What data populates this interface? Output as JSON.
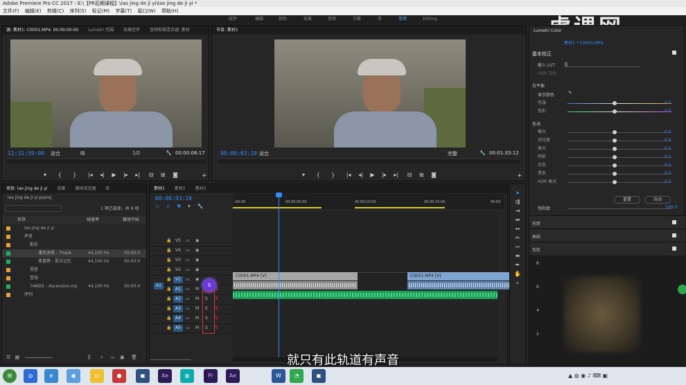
{
  "app": {
    "title": "Adobe Premiere Pro CC 2017 - E:\\【PR后期课程】\\lao jing de ji yi\\lao jing de ji yi *"
  },
  "menu": [
    "文件(F)",
    "编辑(E)",
    "剪辑(C)",
    "序列(S)",
    "标记(M)",
    "字幕(T)",
    "窗口(W)",
    "帮助(H)"
  ],
  "workspaces": [
    "组件",
    "编辑",
    "颜色",
    "效果",
    "音频",
    "字幕",
    "库",
    "常用",
    "Editing"
  ],
  "watermark": "虎课网",
  "source_panel": {
    "tabs": [
      "源: 素材1: C0001.MP4: 00:00:00:00",
      "Lumetri 范围",
      "效果控件",
      "音频剪辑混合器: 素材"
    ],
    "timecode": "12:31:59:00",
    "fit": "适合",
    "ratio": "1/2",
    "duration": "00:00:06:17"
  },
  "program_panel": {
    "tabs": [
      "节目: 素材1"
    ],
    "timecode": "00:00:03:10",
    "fit": "适合",
    "quality": "完整",
    "duration": "00:01:35:12"
  },
  "project_panel": {
    "tabs": [
      "项目: lao jing de ji yi",
      "效果",
      "媒体浏览器",
      "库"
    ],
    "filename": "lao jing de ji yi.prproj",
    "selection": "1 项已选择，共 9 项",
    "columns": [
      "名称",
      "帧速率",
      "媒体开始"
    ],
    "rows": [
      {
        "name": "lao jing de ji yi",
        "rate": "",
        "start": "",
        "color": "#e8a13a"
      },
      {
        "name": "声音",
        "rate": "",
        "start": "",
        "color": "#e8a13a"
      },
      {
        "name": "配乐",
        "rate": "",
        "start": "",
        "color": "#e8a13a"
      },
      {
        "name": "潘若迪恩 - Thank",
        "rate": "44,100 Hz",
        "start": "00:00:0",
        "color": "#1fb35a"
      },
      {
        "name": "蒋喜鹊 - 夏日记忆",
        "rate": "44,100 Hz",
        "start": "00:00:0",
        "color": "#1fb35a"
      },
      {
        "name": "视音",
        "rate": "",
        "start": "",
        "color": "#e8a13a"
      },
      {
        "name": "音效",
        "rate": "",
        "start": "",
        "color": "#e8a13a"
      },
      {
        "name": "7AND5 - Ascension.mp",
        "rate": "44,100 Hz",
        "start": "00:00:0",
        "color": "#1fb35a"
      },
      {
        "name": "序列",
        "rate": "",
        "start": "",
        "color": "#e8a13a"
      }
    ]
  },
  "timeline": {
    "tabs": [
      "素材1",
      "素材2",
      "素材3"
    ],
    "timecode": "00:00:03:10",
    "ruler": [
      ":00:00",
      "00:00:05:00",
      "00:00:10:00",
      "00:00:15:00",
      "00:00"
    ],
    "video_tracks": [
      "V5",
      "V4",
      "V3",
      "V2",
      "V1"
    ],
    "audio_tracks": [
      "A1",
      "A2",
      "A3",
      "A4",
      "A5"
    ],
    "source_patch": "A1",
    "clips": [
      {
        "label": "C0001.MP4 [V]",
        "start": 0,
        "end": 5.0
      },
      {
        "label": "C0051.MP4 [V]",
        "start": 7.0,
        "end": 11.5
      }
    ],
    "mute_letter": "M",
    "solo_letter": "S",
    "solo_button": "S",
    "mute_active": "M"
  },
  "lumetri": {
    "title": "Lumetri Color",
    "clip": "素材1 * C0001.MP4",
    "section": "基本校正",
    "lut_label": "输入 LUT",
    "lut_value": "无",
    "hdr_label": "HDR 白色",
    "wb_label": "白平衡",
    "picker_label": "显示颜色",
    "wb": [
      {
        "label": "色温",
        "value": "0.0"
      },
      {
        "label": "色彩",
        "value": "0.0"
      }
    ],
    "tone_label": "色调",
    "tone": [
      {
        "label": "曝光",
        "value": "0.0"
      },
      {
        "label": "对比度",
        "value": "0.0"
      },
      {
        "label": "高光",
        "value": "0.0"
      },
      {
        "label": "阴影",
        "value": "0.0"
      },
      {
        "label": "白色",
        "value": "0.0"
      },
      {
        "label": "黑色",
        "value": "0.0"
      },
      {
        "label": "HDR 高光",
        "value": "0.0"
      }
    ],
    "reset": "重置",
    "auto": "自动",
    "saturation_label": "饱和度",
    "saturation_value": "100.0",
    "sections": [
      "创意",
      "曲线",
      "色轮"
    ]
  },
  "scope": [
    "8",
    "6",
    "4",
    "2"
  ],
  "subtitle": "就只有此轨道有声音",
  "taskbar": {
    "apps": [
      "Ae",
      "Pr",
      "Ae",
      "W"
    ]
  }
}
